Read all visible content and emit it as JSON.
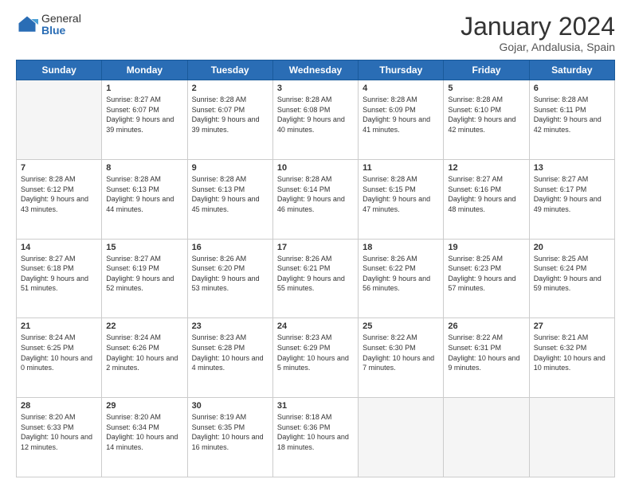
{
  "header": {
    "logo_general": "General",
    "logo_blue": "Blue",
    "month_year": "January 2024",
    "location": "Gojar, Andalusia, Spain"
  },
  "days_of_week": [
    "Sunday",
    "Monday",
    "Tuesday",
    "Wednesday",
    "Thursday",
    "Friday",
    "Saturday"
  ],
  "weeks": [
    [
      {
        "day": "",
        "sunrise": "",
        "sunset": "",
        "daylight": "",
        "empty": true
      },
      {
        "day": "1",
        "sunrise": "Sunrise: 8:27 AM",
        "sunset": "Sunset: 6:07 PM",
        "daylight": "Daylight: 9 hours and 39 minutes.",
        "empty": false
      },
      {
        "day": "2",
        "sunrise": "Sunrise: 8:28 AM",
        "sunset": "Sunset: 6:07 PM",
        "daylight": "Daylight: 9 hours and 39 minutes.",
        "empty": false
      },
      {
        "day": "3",
        "sunrise": "Sunrise: 8:28 AM",
        "sunset": "Sunset: 6:08 PM",
        "daylight": "Daylight: 9 hours and 40 minutes.",
        "empty": false
      },
      {
        "day": "4",
        "sunrise": "Sunrise: 8:28 AM",
        "sunset": "Sunset: 6:09 PM",
        "daylight": "Daylight: 9 hours and 41 minutes.",
        "empty": false
      },
      {
        "day": "5",
        "sunrise": "Sunrise: 8:28 AM",
        "sunset": "Sunset: 6:10 PM",
        "daylight": "Daylight: 9 hours and 42 minutes.",
        "empty": false
      },
      {
        "day": "6",
        "sunrise": "Sunrise: 8:28 AM",
        "sunset": "Sunset: 6:11 PM",
        "daylight": "Daylight: 9 hours and 42 minutes.",
        "empty": false
      }
    ],
    [
      {
        "day": "7",
        "sunrise": "Sunrise: 8:28 AM",
        "sunset": "Sunset: 6:12 PM",
        "daylight": "Daylight: 9 hours and 43 minutes.",
        "empty": false
      },
      {
        "day": "8",
        "sunrise": "Sunrise: 8:28 AM",
        "sunset": "Sunset: 6:13 PM",
        "daylight": "Daylight: 9 hours and 44 minutes.",
        "empty": false
      },
      {
        "day": "9",
        "sunrise": "Sunrise: 8:28 AM",
        "sunset": "Sunset: 6:13 PM",
        "daylight": "Daylight: 9 hours and 45 minutes.",
        "empty": false
      },
      {
        "day": "10",
        "sunrise": "Sunrise: 8:28 AM",
        "sunset": "Sunset: 6:14 PM",
        "daylight": "Daylight: 9 hours and 46 minutes.",
        "empty": false
      },
      {
        "day": "11",
        "sunrise": "Sunrise: 8:28 AM",
        "sunset": "Sunset: 6:15 PM",
        "daylight": "Daylight: 9 hours and 47 minutes.",
        "empty": false
      },
      {
        "day": "12",
        "sunrise": "Sunrise: 8:27 AM",
        "sunset": "Sunset: 6:16 PM",
        "daylight": "Daylight: 9 hours and 48 minutes.",
        "empty": false
      },
      {
        "day": "13",
        "sunrise": "Sunrise: 8:27 AM",
        "sunset": "Sunset: 6:17 PM",
        "daylight": "Daylight: 9 hours and 49 minutes.",
        "empty": false
      }
    ],
    [
      {
        "day": "14",
        "sunrise": "Sunrise: 8:27 AM",
        "sunset": "Sunset: 6:18 PM",
        "daylight": "Daylight: 9 hours and 51 minutes.",
        "empty": false
      },
      {
        "day": "15",
        "sunrise": "Sunrise: 8:27 AM",
        "sunset": "Sunset: 6:19 PM",
        "daylight": "Daylight: 9 hours and 52 minutes.",
        "empty": false
      },
      {
        "day": "16",
        "sunrise": "Sunrise: 8:26 AM",
        "sunset": "Sunset: 6:20 PM",
        "daylight": "Daylight: 9 hours and 53 minutes.",
        "empty": false
      },
      {
        "day": "17",
        "sunrise": "Sunrise: 8:26 AM",
        "sunset": "Sunset: 6:21 PM",
        "daylight": "Daylight: 9 hours and 55 minutes.",
        "empty": false
      },
      {
        "day": "18",
        "sunrise": "Sunrise: 8:26 AM",
        "sunset": "Sunset: 6:22 PM",
        "daylight": "Daylight: 9 hours and 56 minutes.",
        "empty": false
      },
      {
        "day": "19",
        "sunrise": "Sunrise: 8:25 AM",
        "sunset": "Sunset: 6:23 PM",
        "daylight": "Daylight: 9 hours and 57 minutes.",
        "empty": false
      },
      {
        "day": "20",
        "sunrise": "Sunrise: 8:25 AM",
        "sunset": "Sunset: 6:24 PM",
        "daylight": "Daylight: 9 hours and 59 minutes.",
        "empty": false
      }
    ],
    [
      {
        "day": "21",
        "sunrise": "Sunrise: 8:24 AM",
        "sunset": "Sunset: 6:25 PM",
        "daylight": "Daylight: 10 hours and 0 minutes.",
        "empty": false
      },
      {
        "day": "22",
        "sunrise": "Sunrise: 8:24 AM",
        "sunset": "Sunset: 6:26 PM",
        "daylight": "Daylight: 10 hours and 2 minutes.",
        "empty": false
      },
      {
        "day": "23",
        "sunrise": "Sunrise: 8:23 AM",
        "sunset": "Sunset: 6:28 PM",
        "daylight": "Daylight: 10 hours and 4 minutes.",
        "empty": false
      },
      {
        "day": "24",
        "sunrise": "Sunrise: 8:23 AM",
        "sunset": "Sunset: 6:29 PM",
        "daylight": "Daylight: 10 hours and 5 minutes.",
        "empty": false
      },
      {
        "day": "25",
        "sunrise": "Sunrise: 8:22 AM",
        "sunset": "Sunset: 6:30 PM",
        "daylight": "Daylight: 10 hours and 7 minutes.",
        "empty": false
      },
      {
        "day": "26",
        "sunrise": "Sunrise: 8:22 AM",
        "sunset": "Sunset: 6:31 PM",
        "daylight": "Daylight: 10 hours and 9 minutes.",
        "empty": false
      },
      {
        "day": "27",
        "sunrise": "Sunrise: 8:21 AM",
        "sunset": "Sunset: 6:32 PM",
        "daylight": "Daylight: 10 hours and 10 minutes.",
        "empty": false
      }
    ],
    [
      {
        "day": "28",
        "sunrise": "Sunrise: 8:20 AM",
        "sunset": "Sunset: 6:33 PM",
        "daylight": "Daylight: 10 hours and 12 minutes.",
        "empty": false
      },
      {
        "day": "29",
        "sunrise": "Sunrise: 8:20 AM",
        "sunset": "Sunset: 6:34 PM",
        "daylight": "Daylight: 10 hours and 14 minutes.",
        "empty": false
      },
      {
        "day": "30",
        "sunrise": "Sunrise: 8:19 AM",
        "sunset": "Sunset: 6:35 PM",
        "daylight": "Daylight: 10 hours and 16 minutes.",
        "empty": false
      },
      {
        "day": "31",
        "sunrise": "Sunrise: 8:18 AM",
        "sunset": "Sunset: 6:36 PM",
        "daylight": "Daylight: 10 hours and 18 minutes.",
        "empty": false
      },
      {
        "day": "",
        "sunrise": "",
        "sunset": "",
        "daylight": "",
        "empty": true
      },
      {
        "day": "",
        "sunrise": "",
        "sunset": "",
        "daylight": "",
        "empty": true
      },
      {
        "day": "",
        "sunrise": "",
        "sunset": "",
        "daylight": "",
        "empty": true
      }
    ]
  ]
}
